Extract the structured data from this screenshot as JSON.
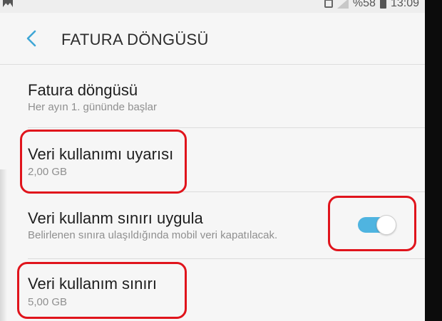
{
  "status_bar": {
    "battery_text": "%58",
    "time": "13:09",
    "icons": [
      "gallery-icon",
      "sim-icon",
      "signal-icon",
      "battery-icon"
    ]
  },
  "header": {
    "back_icon": "chevron-left-icon",
    "title": "FATURA DÖNGÜSÜ"
  },
  "settings": {
    "billing_cycle": {
      "title": "Fatura döngüsü",
      "subtitle": "Her ayın 1. gününde başlar"
    },
    "usage_warning": {
      "title": "Veri kullanımı uyarısı",
      "subtitle": "2,00 GB"
    },
    "apply_limit": {
      "title": "Veri kullanm sınırı uygula",
      "subtitle": "Belirlenen sınıra ulaşıldığında mobil veri kapatılacak.",
      "toggle_on": true
    },
    "usage_limit": {
      "title": "Veri kullanım sınırı",
      "subtitle": "5,00 GB"
    }
  },
  "colors": {
    "accent": "#4fb4e0",
    "back_arrow": "#3fa7d6",
    "annotation": "#e0141c"
  }
}
